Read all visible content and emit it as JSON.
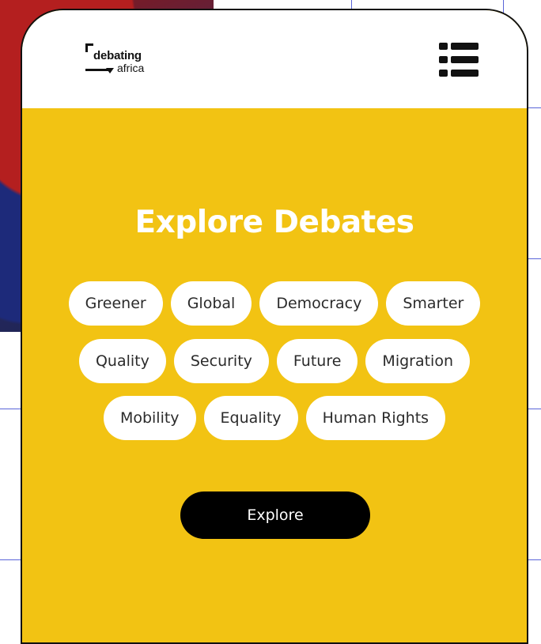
{
  "header": {
    "logo": {
      "line1": "debating",
      "line2": "africa"
    }
  },
  "hero": {
    "title": "Explore Debates",
    "tags": [
      [
        "Greener",
        "Global",
        "Democracy",
        "Smarter"
      ],
      [
        "Quality",
        "Security",
        "Future",
        "Migration"
      ],
      [
        "Mobility",
        "Equality",
        "Human Rights"
      ]
    ],
    "button_label": "Explore"
  },
  "colors": {
    "accent_yellow": "#f2c313",
    "button_black": "#000000",
    "tag_background": "#ffffff",
    "grid_line": "#5964d8"
  },
  "icons": {
    "menu": "list-menu-icon"
  }
}
